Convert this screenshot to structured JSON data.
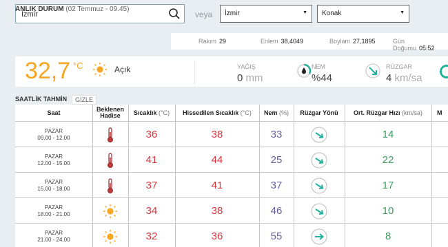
{
  "search": {
    "value": "İzmir",
    "veya": "veya"
  },
  "selects": {
    "il": "İzmir",
    "ilce": "Konak"
  },
  "anlik": {
    "title": "ANLIK DURUM",
    "date": "(02 Temmuz - 09.45)",
    "rakim_label": "Rakım",
    "rakim_val": "29",
    "enlem_label": "Enlem",
    "enlem_val": "38,4049",
    "boylam_label": "Boylam",
    "boylam_val": "27,1895",
    "gun_label": "Gün Doğumu",
    "gun_val": "05:52",
    "temp": "32,7",
    "unit": "°C",
    "desc": "Açık",
    "yagis_label": "YAĞIŞ",
    "yagis_val": "0",
    "yagis_unit": "mm",
    "nem_label": "NEM",
    "nem_val": "%44",
    "ruzgar_label": "RÜZGAR",
    "ruzgar_val": "4",
    "ruzgar_unit": "km/sa"
  },
  "saatlik": {
    "title": "SAATLİK TAHMİN",
    "gizle": "GİZLE",
    "headers": {
      "saat": "Saat",
      "hadise1": "Beklenen",
      "hadise2": "Hadise",
      "sicaklik": "Sıcaklık",
      "sicaklik_unit": "(°C)",
      "hissedilen": "Hissedilen Sıcaklık",
      "hissedilen_unit": "(°C)",
      "nem": "Nem",
      "nem_unit": "(%)",
      "yon": "Rüzgar Yönü",
      "hiz": "Ort. Rüzgar Hızı",
      "hiz_unit": "(km/sa)",
      "more": "M"
    },
    "rows": [
      {
        "day": "PAZAR",
        "time": "09.00 - 12.00",
        "hadise": "thermometer-icon",
        "sicaklik": "36",
        "hissedilen": "38",
        "nem": "33",
        "yon": "southeast",
        "hiz": "14"
      },
      {
        "day": "PAZAR",
        "time": "12.00 - 15.00",
        "hadise": "thermometer-icon",
        "sicaklik": "41",
        "hissedilen": "44",
        "nem": "25",
        "yon": "southeast",
        "hiz": "22"
      },
      {
        "day": "PAZAR",
        "time": "15.00 - 18.00",
        "hadise": "thermometer-icon",
        "sicaklik": "37",
        "hissedilen": "41",
        "nem": "37",
        "yon": "southeast",
        "hiz": "17"
      },
      {
        "day": "PAZAR",
        "time": "18.00 - 21.00",
        "hadise": "sun-icon",
        "sicaklik": "34",
        "hissedilen": "38",
        "nem": "46",
        "yon": "southeast",
        "hiz": "10"
      },
      {
        "day": "PAZAR",
        "time": "21.00 - 24.00",
        "hadise": "sun-icon",
        "sicaklik": "32",
        "hissedilen": "36",
        "nem": "55",
        "yon": "east",
        "hiz": "8"
      }
    ]
  },
  "colors": {
    "accent": "#f5a623",
    "green": "#23b19a",
    "red": "#d9353d",
    "purple": "#6a5c9c",
    "wind_green": "#3f9a62"
  }
}
